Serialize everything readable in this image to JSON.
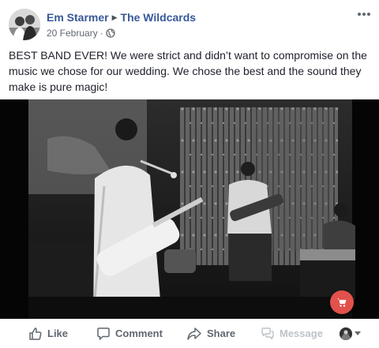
{
  "post": {
    "author": "Em Starmer",
    "target_page": "The Wildcards",
    "date": "20 February",
    "separator": "·",
    "privacy_icon": "globe-icon",
    "text": "BEST BAND EVER! We were strict and didn’t want to compromise on the music we chose for our wedding. We chose the best and the sound they make is pure magic!",
    "photo_icon": "band-photo",
    "shop_icon": "shopping-cart-icon",
    "shop_color": "#e2514b"
  },
  "actions": {
    "like": "Like",
    "comment": "Comment",
    "share": "Share",
    "message": "Message"
  },
  "colors": {
    "link": "#385898",
    "secondary": "#616770",
    "disabled": "#bec3c9"
  }
}
